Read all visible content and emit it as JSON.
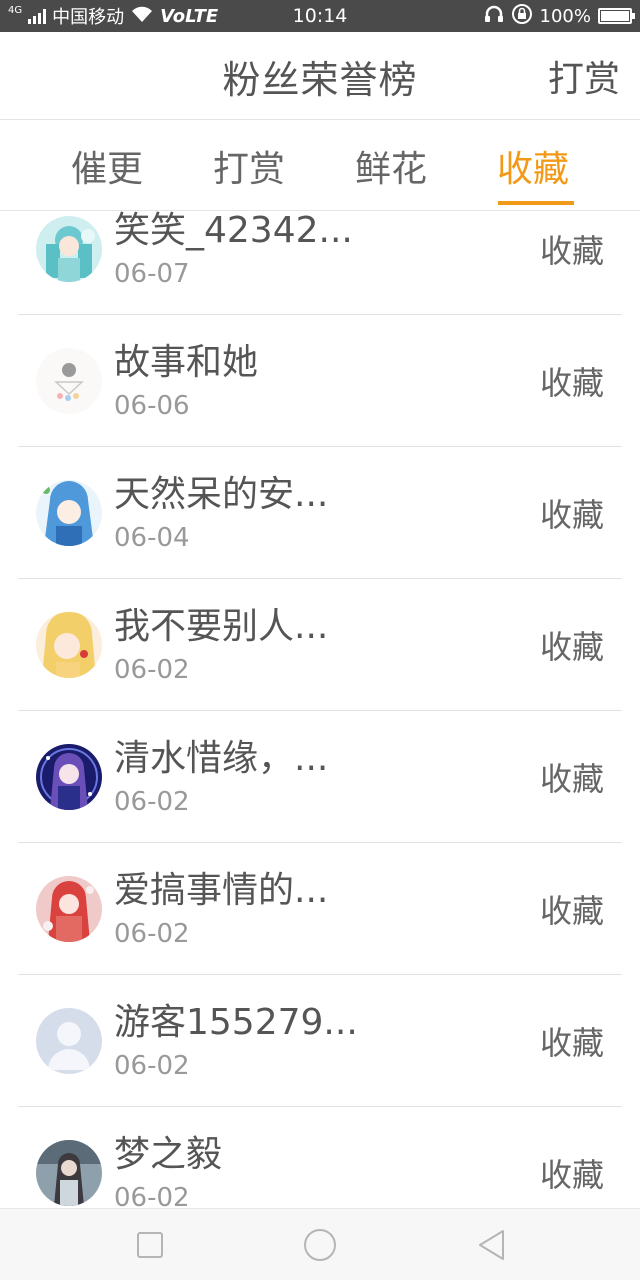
{
  "status_bar": {
    "carrier": "中国移动",
    "network_badge": "4G",
    "volte": "VoLTE",
    "time": "10:14",
    "battery": "100%",
    "icons": [
      "signal-icon",
      "wifi-icon",
      "headphone-icon",
      "rotation-lock-icon",
      "battery-icon"
    ]
  },
  "header": {
    "title": "粉丝荣誉榜",
    "right_action": "打赏"
  },
  "tabs": [
    {
      "label": "催更",
      "active": false
    },
    {
      "label": "打赏",
      "active": false
    },
    {
      "label": "鲜花",
      "active": false
    },
    {
      "label": "收藏",
      "active": true
    }
  ],
  "accent_color": "#f29a18",
  "list": [
    {
      "name": "笑笑_42342...",
      "date": "06-07",
      "action": "收藏",
      "avatar": "anime-girl-teal-avatar"
    },
    {
      "name": "故事和她",
      "date": "06-06",
      "action": "收藏",
      "avatar": "pastel-doodle-avatar"
    },
    {
      "name": "天然呆的安...",
      "date": "06-04",
      "action": "收藏",
      "avatar": "anime-girl-blue-hair-avatar"
    },
    {
      "name": "我不要别人...",
      "date": "06-02",
      "action": "收藏",
      "avatar": "anime-girl-blonde-avatar"
    },
    {
      "name": "清水惜缘，...",
      "date": "06-02",
      "action": "收藏",
      "avatar": "anime-girl-dark-blue-avatar"
    },
    {
      "name": "爱搞事情的...",
      "date": "06-02",
      "action": "收藏",
      "avatar": "anime-girl-red-avatar"
    },
    {
      "name": "游客155279...",
      "date": "06-02",
      "action": "收藏",
      "avatar": "default-user-avatar"
    },
    {
      "name": "梦之毅",
      "date": "06-02",
      "action": "收藏",
      "avatar": "photo-avatar"
    }
  ],
  "nav_bar": {
    "icons": [
      "recent-apps-icon",
      "home-icon",
      "back-icon"
    ]
  }
}
